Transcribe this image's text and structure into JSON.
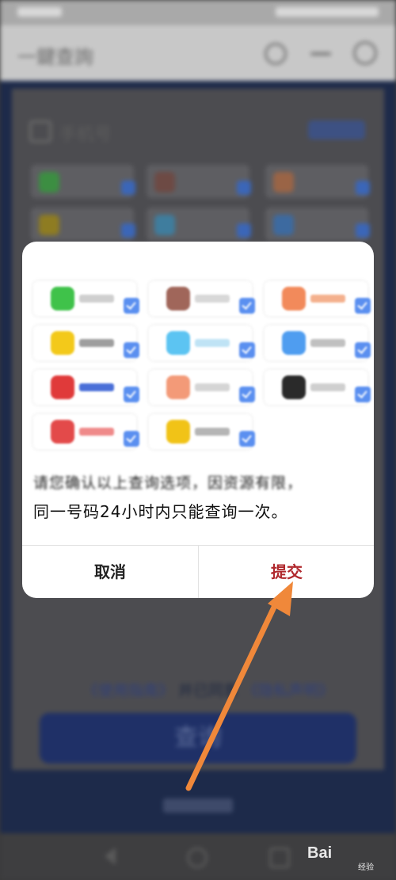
{
  "app_bar": {
    "title": "一鍵查詢"
  },
  "background": {
    "section_title": "手机号",
    "link_prefix": "《使用指南》",
    "link_mid": " 并已同意 ",
    "link_suffix": "《隐私声明》",
    "query_button": "查询"
  },
  "dialog": {
    "message_line1": "请您确认以上查询选项，因资源有限，",
    "message_line2": "同一号码24小时内只能查询一次。",
    "cancel_label": "取消",
    "submit_label": "提交",
    "options": [
      {
        "icon": "wechat-logo-icon",
        "color": "#3fc24a",
        "text_color": "#cfcfcf"
      },
      {
        "icon": "app-logo-brown-icon",
        "color": "#a0665a",
        "text_color": "#d8d8d8"
      },
      {
        "icon": "app-logo-orange-icon",
        "color": "#f28a5b",
        "text_color": "#f4b08d"
      },
      {
        "icon": "app-logo-yellow-icon",
        "color": "#f3c91a",
        "text_color": "#9e9e9e"
      },
      {
        "icon": "app-logo-lightblue-icon",
        "color": "#5cc4f2",
        "text_color": "#bfe3f5"
      },
      {
        "icon": "app-logo-blue-icon",
        "color": "#4f9df0",
        "text_color": "#c0c0c0"
      },
      {
        "icon": "baidu-logo-icon",
        "color": "#e03a3a",
        "text_color": "#4a6fd8"
      },
      {
        "icon": "app-logo-salmon-icon",
        "color": "#f39a78",
        "text_color": "#d5d5d5"
      },
      {
        "icon": "app-logo-dark-icon",
        "color": "#2a2a2a",
        "text_color": "#cfcfcf"
      },
      {
        "icon": "app-logo-red-icon",
        "color": "#e34a4a",
        "text_color": "#ef8a8a"
      },
      {
        "icon": "app-logo-gold-icon",
        "color": "#f1c317",
        "text_color": "#b5b5b5"
      }
    ]
  },
  "watermark": {
    "text": "Bai",
    "sub": "经验"
  },
  "colors": {
    "accent": "#b0282d",
    "check": "#5a8ff0",
    "arrow": "#f0883a"
  }
}
